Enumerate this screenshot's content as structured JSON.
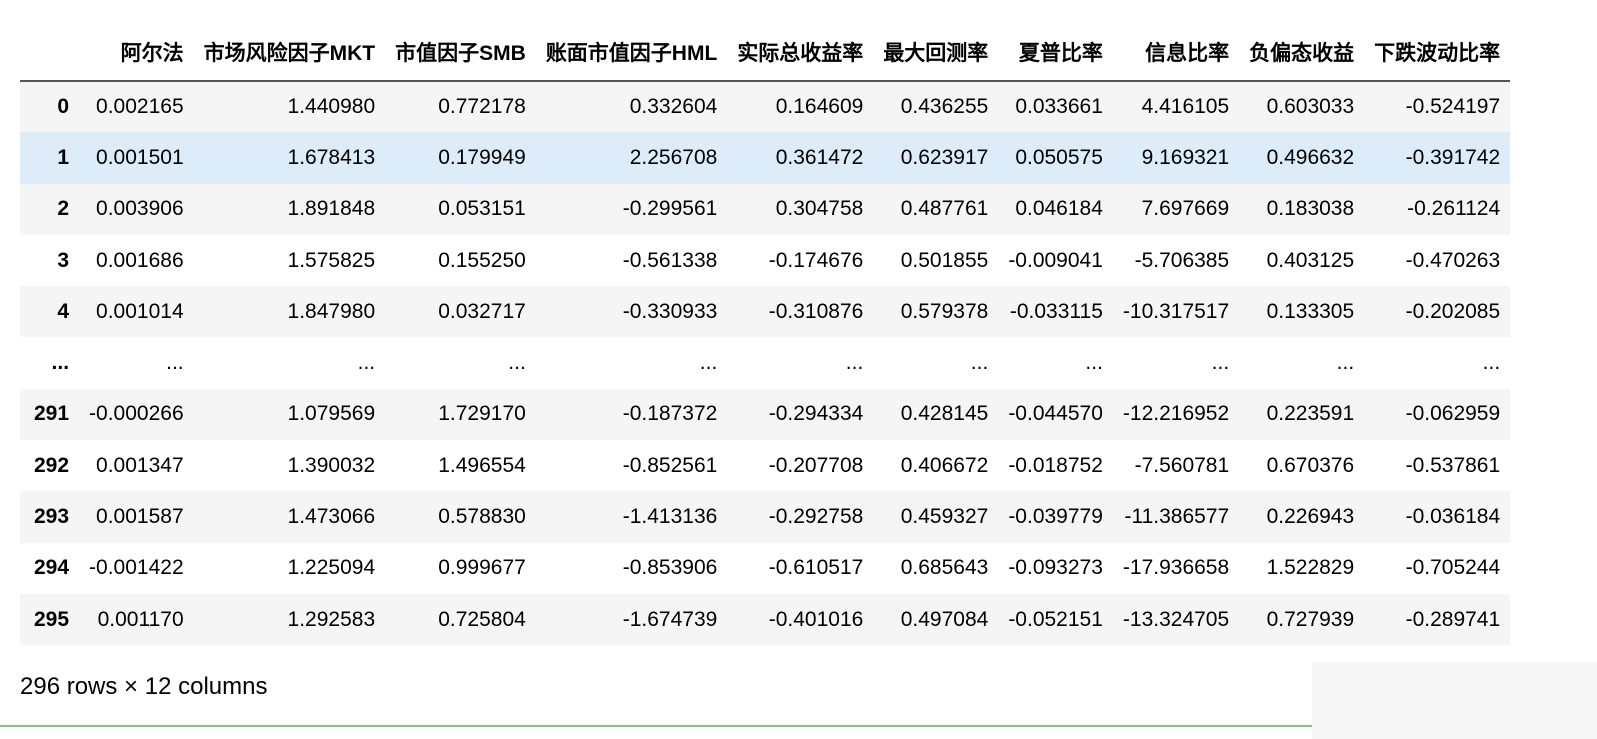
{
  "columns": [
    "阿尔法",
    "市场风险因子MKT",
    "市值因子SMB",
    "账面市值因子HML",
    "实际总收益率",
    "最大回测率",
    "夏普比率",
    "信息比率",
    "负偏态收益",
    "下跌波动比率"
  ],
  "rows": [
    {
      "index": "0",
      "cells": [
        "0.002165",
        "1.440980",
        "0.772178",
        "0.332604",
        "0.164609",
        "0.436255",
        "0.033661",
        "4.416105",
        "0.603033",
        "-0.524197"
      ]
    },
    {
      "index": "1",
      "cells": [
        "0.001501",
        "1.678413",
        "0.179949",
        "2.256708",
        "0.361472",
        "0.623917",
        "0.050575",
        "9.169321",
        "0.496632",
        "-0.391742"
      ]
    },
    {
      "index": "2",
      "cells": [
        "0.003906",
        "1.891848",
        "0.053151",
        "-0.299561",
        "0.304758",
        "0.487761",
        "0.046184",
        "7.697669",
        "0.183038",
        "-0.261124"
      ]
    },
    {
      "index": "3",
      "cells": [
        "0.001686",
        "1.575825",
        "0.155250",
        "-0.561338",
        "-0.174676",
        "0.501855",
        "-0.009041",
        "-5.706385",
        "0.403125",
        "-0.470263"
      ]
    },
    {
      "index": "4",
      "cells": [
        "0.001014",
        "1.847980",
        "0.032717",
        "-0.330933",
        "-0.310876",
        "0.579378",
        "-0.033115",
        "-10.317517",
        "0.133305",
        "-0.202085"
      ]
    },
    {
      "index": "...",
      "cells": [
        "...",
        "...",
        "...",
        "...",
        "...",
        "...",
        "...",
        "...",
        "...",
        "..."
      ]
    },
    {
      "index": "291",
      "cells": [
        "-0.000266",
        "1.079569",
        "1.729170",
        "-0.187372",
        "-0.294334",
        "0.428145",
        "-0.044570",
        "-12.216952",
        "0.223591",
        "-0.062959"
      ]
    },
    {
      "index": "292",
      "cells": [
        "0.001347",
        "1.390032",
        "1.496554",
        "-0.852561",
        "-0.207708",
        "0.406672",
        "-0.018752",
        "-7.560781",
        "0.670376",
        "-0.537861"
      ]
    },
    {
      "index": "293",
      "cells": [
        "0.001587",
        "1.473066",
        "0.578830",
        "-1.413136",
        "-0.292758",
        "0.459327",
        "-0.039779",
        "-11.386577",
        "0.226943",
        "-0.036184"
      ]
    },
    {
      "index": "294",
      "cells": [
        "-0.001422",
        "1.225094",
        "0.999677",
        "-0.853906",
        "-0.610517",
        "0.685643",
        "-0.093273",
        "-17.936658",
        "1.522829",
        "-0.705244"
      ]
    },
    {
      "index": "295",
      "cells": [
        "0.001170",
        "1.292583",
        "0.725804",
        "-1.674739",
        "-0.401016",
        "0.497084",
        "-0.052151",
        "-13.324705",
        "0.727939",
        "-0.289741"
      ]
    }
  ],
  "hovered_row": "1",
  "shape_caption": "296 rows × 12 columns",
  "colors": {
    "row_stripe": "#f5f5f5",
    "row_hover": "#dcecf9",
    "header_border": "#555555",
    "cell_border_bottom": "#7cc47c"
  }
}
